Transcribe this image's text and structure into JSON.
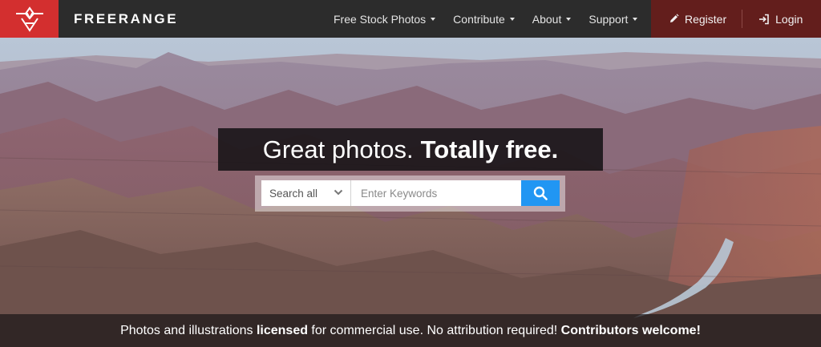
{
  "brand": {
    "name": "FREERANGE",
    "logo_icon": "freerange-logo-icon",
    "accent": "#d32f2f"
  },
  "nav": {
    "items": [
      {
        "label": "Free Stock Photos",
        "has_dropdown": true
      },
      {
        "label": "Contribute",
        "has_dropdown": true
      },
      {
        "label": "About",
        "has_dropdown": true
      },
      {
        "label": "Support",
        "has_dropdown": true
      }
    ],
    "account": {
      "register_label": "Register",
      "register_icon": "pencil-icon",
      "login_label": "Login",
      "login_icon": "sign-in-icon",
      "background": "#631e1c"
    },
    "background": "#2c2c2c"
  },
  "hero": {
    "headline_light": "Great photos.",
    "headline_bold": "Totally free.",
    "search": {
      "category_selected": "Search all",
      "placeholder": "Enter Keywords",
      "value": "",
      "button_icon": "search-icon",
      "button_color": "#2196f3"
    },
    "tagline": {
      "part1": "Photos and illustrations ",
      "part2_bold": "licensed",
      "part3": " for commercial use. No attribution required! ",
      "part4_bold": "Contributors welcome!"
    }
  }
}
